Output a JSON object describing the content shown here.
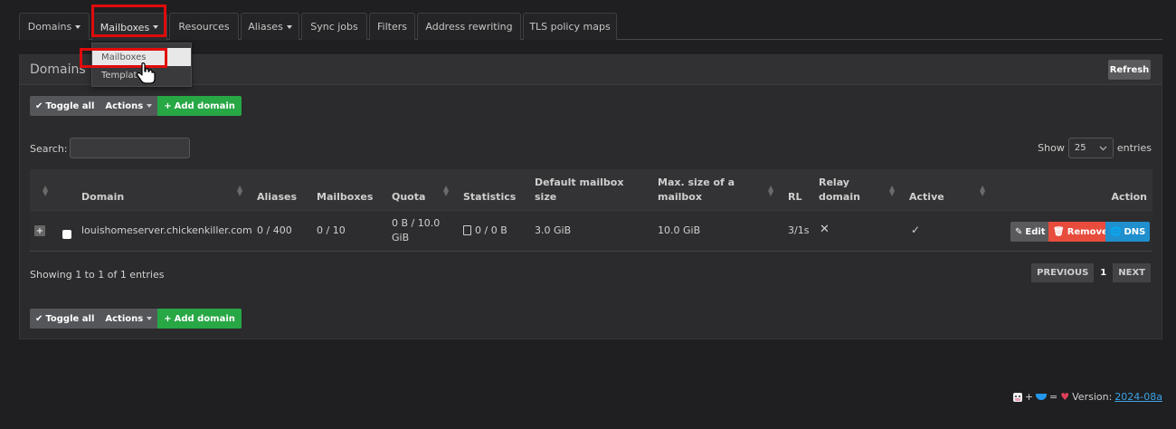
{
  "tabs": [
    {
      "label": "Domains",
      "dropdown": true
    },
    {
      "label": "Mailboxes",
      "dropdown": true
    },
    {
      "label": "Resources",
      "dropdown": false
    },
    {
      "label": "Aliases",
      "dropdown": true
    },
    {
      "label": "Sync jobs",
      "dropdown": false
    },
    {
      "label": "Filters",
      "dropdown": false
    },
    {
      "label": "Address rewriting",
      "dropdown": false
    },
    {
      "label": "TLS policy maps",
      "dropdown": false
    }
  ],
  "dropdown": {
    "items": [
      "Mailboxes",
      "Templates"
    ]
  },
  "panel": {
    "title": "Domains",
    "refresh_label": "Refresh"
  },
  "toolbar": {
    "toggle_all": "Toggle all",
    "actions": "Actions",
    "add_domain": "Add domain"
  },
  "search": {
    "label": "Search:"
  },
  "length": {
    "show": "Show",
    "value": "25",
    "entries": "entries"
  },
  "columns": {
    "domain": "Domain",
    "aliases": "Aliases",
    "mailboxes": "Mailboxes",
    "quota": "Quota",
    "statistics": "Statistics",
    "default_size": "Default mailbox size",
    "max_size": "Max. size of a mailbox",
    "rl": "RL",
    "relay": "Relay domain",
    "active": "Active",
    "action": "Action"
  },
  "rows": [
    {
      "domain": "louishomeserver.chickenkiller.com",
      "aliases": "0 / 400",
      "mailboxes": "0 / 10",
      "quota": "0 B / 10.0 GiB",
      "statistics": "0 / 0 B",
      "default_size": "3.0 GiB",
      "max_size": "10.0 GiB",
      "rl": "3/1s",
      "relay": "✕",
      "active": "✓",
      "actions": {
        "edit": "Edit",
        "remove": "Remove",
        "dns": "DNS"
      }
    }
  ],
  "info": "Showing 1 to 1 of 1 entries",
  "pager": {
    "prev": "PREVIOUS",
    "page": "1",
    "next": "NEXT"
  },
  "footer": {
    "version_label": "Version:",
    "version": "2024-08a"
  },
  "colors": {
    "accent_green": "#28a745",
    "remove_red": "#e74c3c",
    "dns_blue": "#1f8fce",
    "highlight": "#e10b0b"
  }
}
